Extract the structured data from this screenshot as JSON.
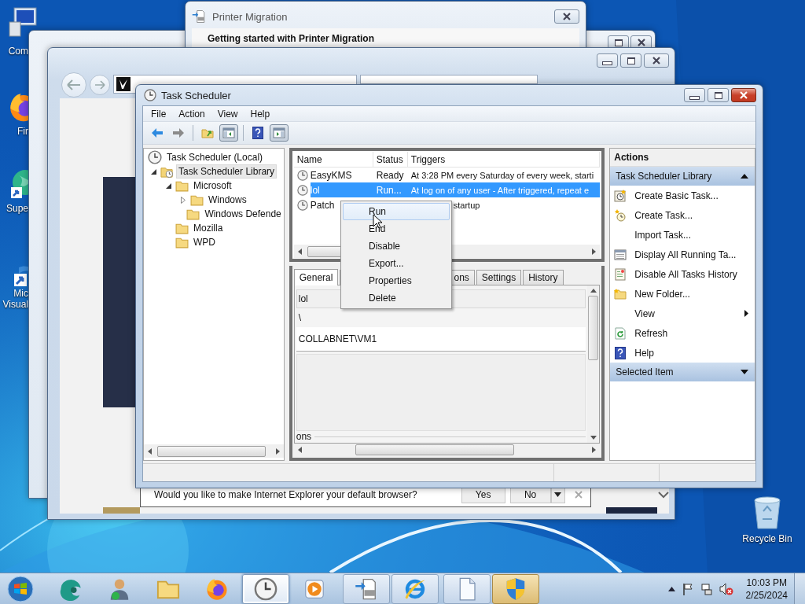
{
  "desktop_icons": [
    {
      "kind": "computer",
      "lines": [
        "Com"
      ]
    },
    {
      "kind": "firefox",
      "lines": [
        "Fir"
      ]
    },
    {
      "kind": "globe",
      "lines": [
        "Supe"
      ]
    },
    {
      "kind": "visual-studio",
      "lines": [
        "Mic",
        "Visual"
      ]
    }
  ],
  "recycle_bin": {
    "label": "Recycle Bin"
  },
  "printer_window": {
    "title": "Printer Migration",
    "heading": "Getting started with Printer Migration"
  },
  "browser_window": {
    "infobar": {
      "text": "Would you like to make Internet Explorer your default browser?",
      "yes": "Yes",
      "no": "No"
    }
  },
  "task_scheduler": {
    "title": "Task Scheduler",
    "menu": [
      "File",
      "Action",
      "View",
      "Help"
    ],
    "toolbar": [
      {
        "kind": "back",
        "pressed": false
      },
      {
        "kind": "forward",
        "pressed": false
      },
      {
        "kind": "up-folder",
        "pressed": false
      },
      {
        "kind": "pane",
        "pressed": true
      },
      {
        "kind": "help",
        "pressed": false
      },
      {
        "kind": "pane-right",
        "pressed": true
      }
    ],
    "tree": [
      {
        "label": "Task Scheduler (Local)",
        "selected": false,
        "children": [
          {
            "label": "Task Scheduler Library",
            "expanded": true,
            "selected": true,
            "children": [
              {
                "label": "Microsoft",
                "expanded": true,
                "selected": false,
                "children": [
                  {
                    "label": "Windows",
                    "expanded": false,
                    "selected": false
                  },
                  {
                    "label": "Windows Defende",
                    "selected": false
                  }
                ]
              },
              {
                "label": "Mozilla",
                "selected": false
              },
              {
                "label": "WPD",
                "selected": false
              }
            ]
          }
        ]
      }
    ],
    "task_columns": [
      "Name",
      "Status",
      "Triggers"
    ],
    "tasks": [
      {
        "name": "EasyKMS",
        "status": "Ready",
        "triggers": "At 3:28 PM every Saturday of every week, starti",
        "selected": false
      },
      {
        "name": "lol",
        "status": "Run...",
        "triggers": "At log on of any user - After triggered, repeat e",
        "selected": true
      },
      {
        "name": "Patch",
        "triggers": "startup",
        "selected": false
      }
    ],
    "context_menu": [
      {
        "label": "Run",
        "selected": true
      },
      {
        "label": "End",
        "selected": false
      },
      {
        "label": "Disable",
        "selected": false
      },
      {
        "label": "Export...",
        "selected": false
      },
      {
        "label": "Properties",
        "selected": false
      },
      {
        "label": "Delete",
        "selected": false
      }
    ],
    "detail_tabs": [
      {
        "label": "General",
        "selected": true
      },
      {
        "label": "ons",
        "selected": false
      },
      {
        "label": "Settings",
        "selected": false
      },
      {
        "label": "History",
        "selected": false
      }
    ],
    "detail_fields": [
      "lol",
      "\\",
      "COLLABNET\\VM1"
    ],
    "detail_group": "ons",
    "actions": {
      "title": "Actions",
      "sections": [
        {
          "title": "Task Scheduler Library",
          "expanded": true,
          "items": [
            {
              "label": "Create Basic Task...",
              "submenu": false
            },
            {
              "label": "Create Task...",
              "submenu": false
            },
            {
              "label": "Import Task...",
              "submenu": false
            },
            {
              "label": "Display All Running Ta...",
              "submenu": false
            },
            {
              "label": "Disable All Tasks History",
              "submenu": false
            },
            {
              "label": "New Folder...",
              "submenu": false
            },
            {
              "label": "View",
              "submenu": true
            },
            {
              "label": "Refresh",
              "submenu": false
            },
            {
              "label": "Help",
              "submenu": false
            }
          ]
        },
        {
          "title": "Selected Item",
          "expanded": false
        }
      ]
    }
  },
  "taskbar": {
    "buttons": [
      {
        "kind": "teal-app",
        "open": false,
        "selected": false
      },
      {
        "kind": "user",
        "open": false,
        "selected": false
      },
      {
        "kind": "folder",
        "open": false,
        "selected": false
      },
      {
        "kind": "firefox",
        "open": false,
        "selected": false
      },
      {
        "kind": "clock",
        "open": true,
        "selected": true
      },
      {
        "kind": "media",
        "open": false,
        "selected": false
      },
      {
        "kind": "printer-migration",
        "open": true,
        "selected": false
      },
      {
        "kind": "ie",
        "open": true,
        "selected": false
      },
      {
        "kind": "document",
        "open": true,
        "selected": false
      },
      {
        "kind": "shield",
        "open": true,
        "selected": false,
        "flashing": true
      }
    ],
    "time": "10:03 PM",
    "date": "2/25/2024"
  }
}
